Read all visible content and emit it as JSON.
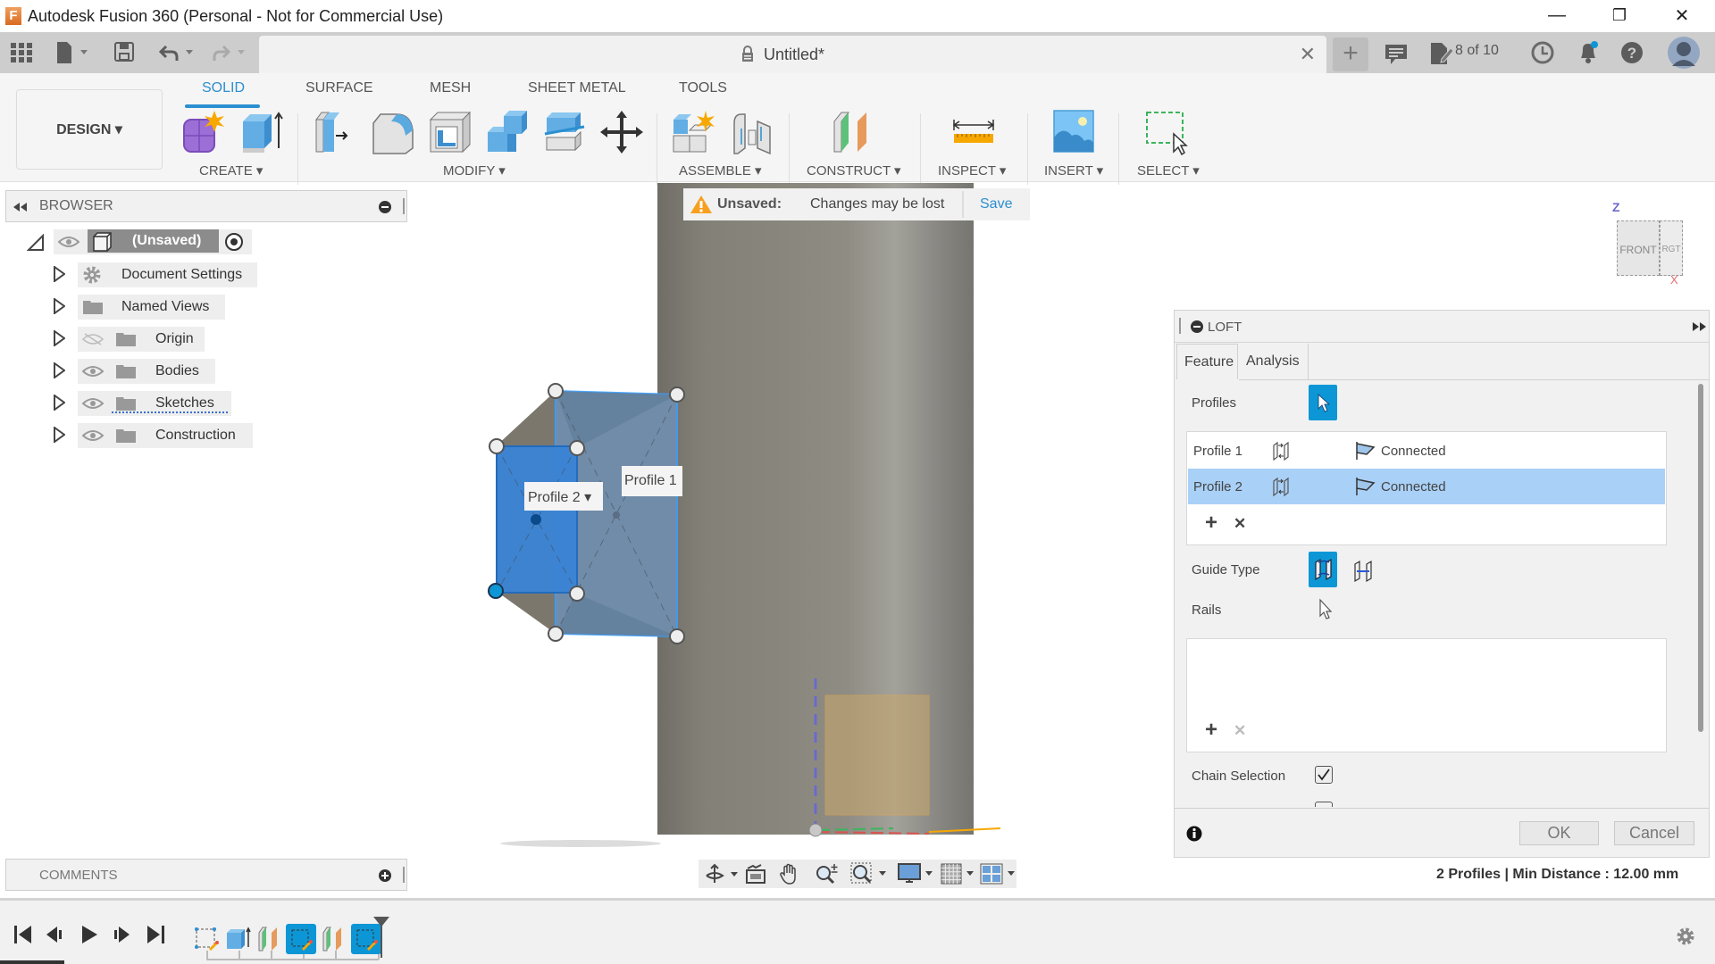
{
  "window": {
    "app_title": "Autodesk Fusion 360 (Personal - Not for Commercial Use)",
    "logo_letter": "F",
    "controls": {
      "minimize": "—",
      "restore": "❐",
      "close": "✕"
    }
  },
  "tabbar": {
    "document_title": "Untitled*",
    "close_glyph": "✕",
    "new_tab_glyph": "+",
    "jobs_count": "8 of 10",
    "icons": [
      "data-panel-icon",
      "file-icon",
      "save-icon",
      "undo-icon",
      "redo-icon",
      "lock-icon",
      "comments-icon",
      "job-status-icon",
      "history-icon",
      "notifications-icon",
      "help-icon",
      "user-avatar"
    ]
  },
  "ribbon": {
    "workspace": "DESIGN ▾",
    "tabs": [
      "SOLID",
      "SURFACE",
      "MESH",
      "SHEET METAL",
      "TOOLS"
    ],
    "active_tab": "SOLID",
    "groups": [
      {
        "label": "CREATE ▾",
        "tools": [
          "create-form-icon",
          "extrude-icon"
        ]
      },
      {
        "label": "MODIFY ▾",
        "tools": [
          "press-pull-icon",
          "fillet-icon",
          "shell-icon",
          "combine-icon",
          "split-body-icon",
          "move-icon"
        ]
      },
      {
        "label": "ASSEMBLE ▾",
        "tools": [
          "new-component-icon",
          "joint-icon"
        ]
      },
      {
        "label": "CONSTRUCT ▾",
        "tools": [
          "offset-plane-icon"
        ]
      },
      {
        "label": "INSPECT ▾",
        "tools": [
          "measure-icon"
        ]
      },
      {
        "label": "INSERT ▾",
        "tools": [
          "insert-image-icon"
        ]
      },
      {
        "label": "SELECT ▾",
        "tools": [
          "select-window-icon"
        ]
      }
    ]
  },
  "browser": {
    "title": "BROWSER",
    "root": "(Unsaved)",
    "items": [
      {
        "label": "Document Settings",
        "icon": "gear-icon",
        "visible": null
      },
      {
        "label": "Named Views",
        "icon": "folder-icon",
        "visible": null
      },
      {
        "label": "Origin",
        "icon": "folder-icon",
        "visible": false
      },
      {
        "label": "Bodies",
        "icon": "folder-icon",
        "visible": true
      },
      {
        "label": "Sketches",
        "icon": "folder-icon",
        "visible": true
      },
      {
        "label": "Construction",
        "icon": "folder-icon",
        "visible": true
      }
    ]
  },
  "banner": {
    "label": "Unsaved:",
    "message": "Changes may be lost",
    "action": "Save"
  },
  "viewport": {
    "profile_labels": [
      "Profile 2 ▾",
      "Profile 1"
    ],
    "viewcube": {
      "front": "FRONT",
      "right": "RGT",
      "z_axis": "Z",
      "x_axis": "X"
    }
  },
  "loft": {
    "title": "LOFT",
    "tabs": [
      "Feature",
      "Analysis"
    ],
    "active_tab": "Feature",
    "profiles_label": "Profiles",
    "profiles": [
      {
        "name": "Profile 1",
        "status": "Connected",
        "selected": false
      },
      {
        "name": "Profile 2",
        "status": "Connected",
        "selected": true
      }
    ],
    "guide_type_label": "Guide Type",
    "rails_label": "Rails",
    "chain_selection_label": "Chain Selection",
    "chain_selection_checked": true,
    "add_glyph": "+",
    "remove_glyph": "✕",
    "ok": "OK",
    "cancel": "Cancel",
    "status": "2 Profiles | Min Distance : 12.00 mm"
  },
  "comments": {
    "title": "COMMENTS"
  },
  "nav_toolbar": [
    "orbit-icon",
    "look-at-icon",
    "pan-icon",
    "zoom-icon",
    "fit-icon",
    "display-settings-icon",
    "grid-icon",
    "viewports-icon"
  ],
  "timeline": {
    "controls": [
      "first-icon",
      "previous-icon",
      "play-icon",
      "next-icon",
      "last-icon"
    ],
    "features": [
      {
        "type": "sketch",
        "active": false
      },
      {
        "type": "extrude",
        "active": false
      },
      {
        "type": "plane",
        "active": false
      },
      {
        "type": "sketch",
        "active": true
      },
      {
        "type": "plane",
        "active": false
      },
      {
        "type": "sketch",
        "active": true
      }
    ]
  }
}
